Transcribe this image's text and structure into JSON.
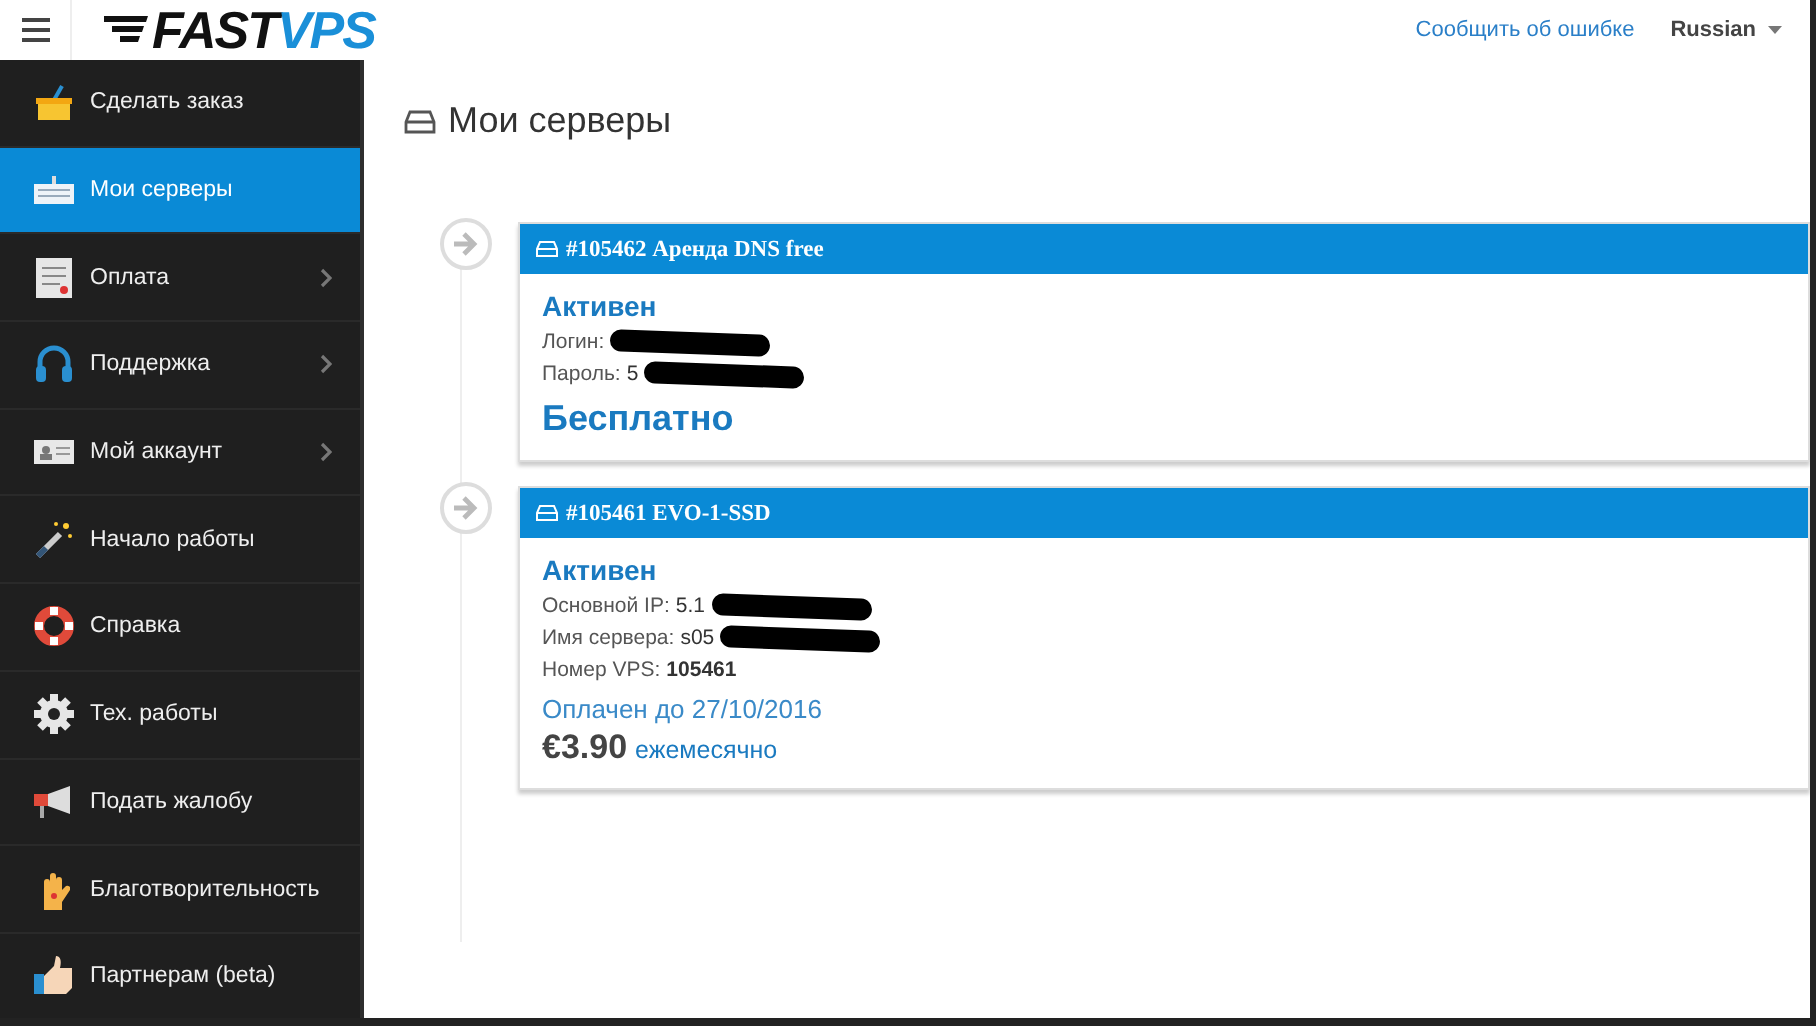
{
  "header": {
    "logo": {
      "part_1": "FAST",
      "part_2": "VPS"
    },
    "report_link": "Сообщить об ошибке",
    "language": "Russian"
  },
  "sidebar": {
    "items": [
      {
        "label": "Сделать заказ",
        "selected": false,
        "has_submenu": false
      },
      {
        "label": "Мои серверы",
        "selected": true,
        "has_submenu": false
      },
      {
        "label": "Оплата",
        "selected": false,
        "has_submenu": true
      },
      {
        "label": "Поддержка",
        "selected": false,
        "has_submenu": true
      },
      {
        "label": "Мой аккаунт",
        "selected": false,
        "has_submenu": true
      },
      {
        "label": "Начало работы",
        "selected": false,
        "has_submenu": false
      },
      {
        "label": "Справка",
        "selected": false,
        "has_submenu": false
      },
      {
        "label": "Тех. работы",
        "selected": false,
        "has_submenu": false
      },
      {
        "label": "Подать жалобу",
        "selected": false,
        "has_submenu": false
      },
      {
        "label": "Благотворительность",
        "selected": false,
        "has_submenu": false
      },
      {
        "label": "Партнерам (beta)",
        "selected": false,
        "has_submenu": false
      }
    ]
  },
  "page_title": "Мои серверы",
  "servers": [
    {
      "title": "#105462 Аренда DNS free",
      "status": "Активен",
      "fields": [
        {
          "label": "Логин:",
          "redacted": true
        },
        {
          "label": "Пароль:",
          "value": "5",
          "redacted": true
        }
      ],
      "price": {
        "kind": "free",
        "text": "Бесплатно"
      }
    },
    {
      "title": "#105461 EVO-1-SSD",
      "status": "Активен",
      "fields": [
        {
          "label": "Основной IP:",
          "value": "5.1",
          "redacted": true
        },
        {
          "label": "Имя сервера:",
          "value": "s05",
          "redacted": true
        },
        {
          "label": "Номер VPS:",
          "value": "105461",
          "redacted": false
        }
      ],
      "paid_until": "Оплачен до 27/10/2016",
      "price": {
        "kind": "monthly",
        "text": "€3.90",
        "period": "ежемесячно"
      }
    }
  ]
}
